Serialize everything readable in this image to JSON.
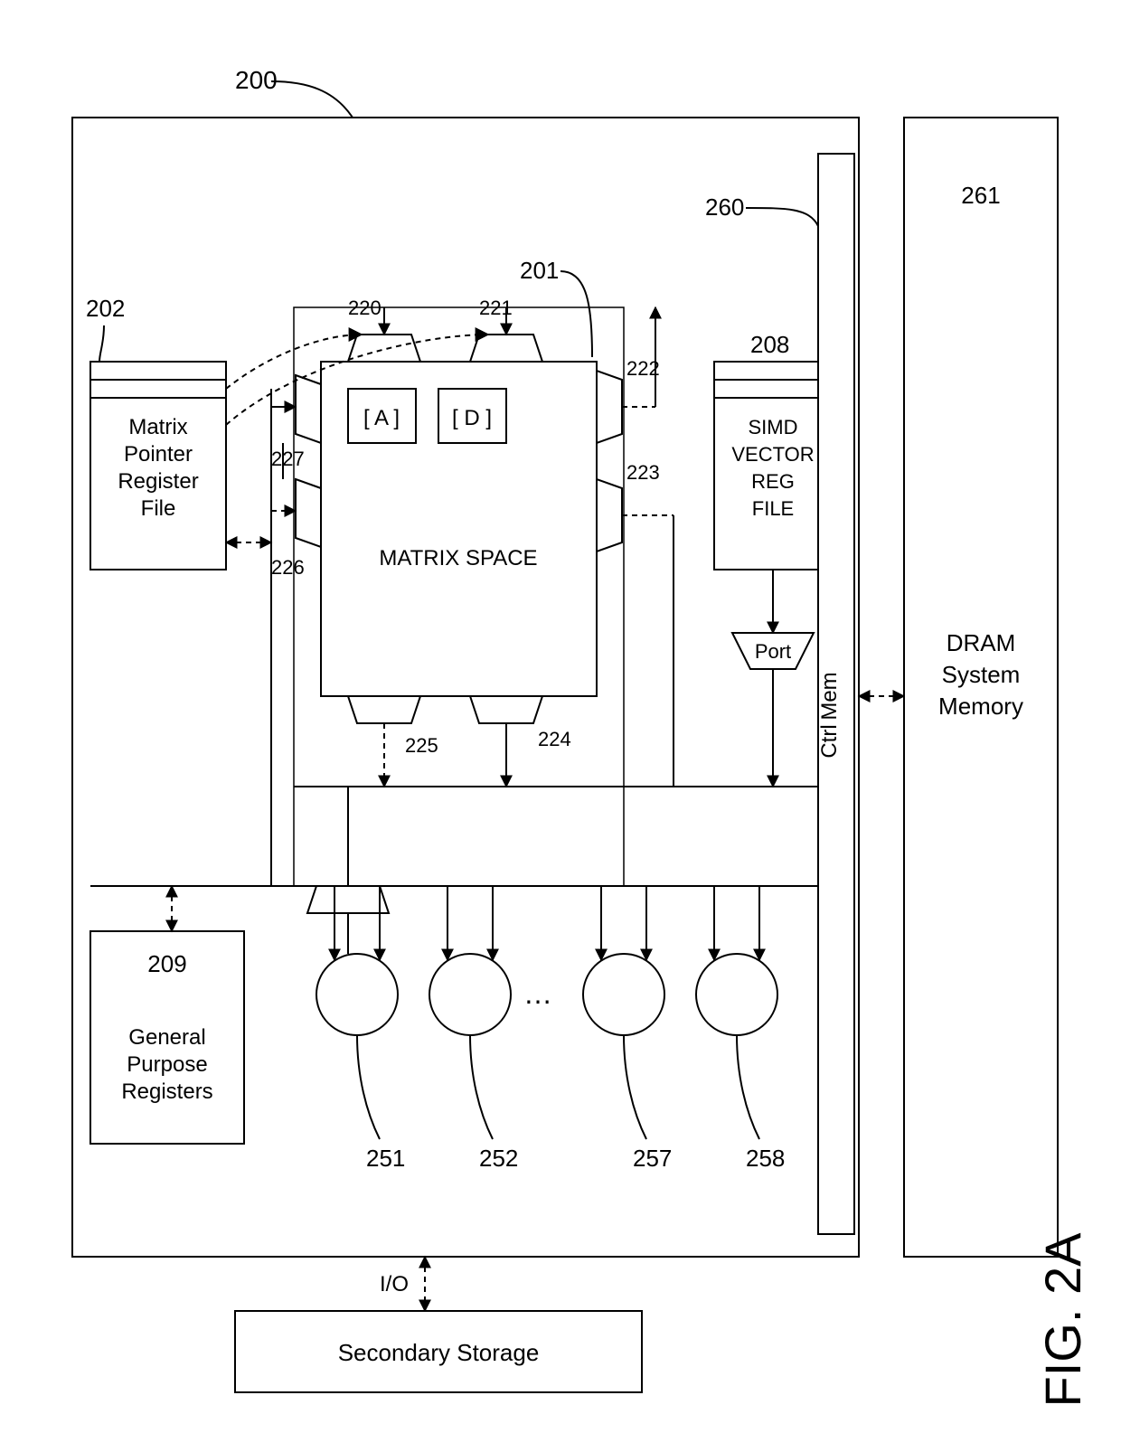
{
  "figure_label": "FIG. 2A",
  "refs": {
    "r200": "200",
    "r201": "201",
    "r202": "202",
    "r208": "208",
    "r209": "209",
    "r220": "220",
    "r221": "221",
    "r222": "222",
    "r223": "223",
    "r224": "224",
    "r225": "225",
    "r226": "226",
    "r227": "227",
    "r251": "251",
    "r252": "252",
    "r257": "257",
    "r258": "258",
    "r260": "260",
    "r261": "261"
  },
  "labels": {
    "matrix_space": "MATRIX SPACE",
    "A": "[ A ]",
    "D": "[ D ]",
    "mpf_1": "Matrix",
    "mpf_2": "Pointer",
    "mpf_3": "Register",
    "mpf_4": "File",
    "gpr_1": "General",
    "gpr_2": "Purpose",
    "gpr_3": "Registers",
    "simd_1": "SIMD",
    "simd_2": "VECTOR",
    "simd_3": "REG",
    "simd_4": "FILE",
    "port": "Port",
    "memctrl_1": "Mem",
    "memctrl_2": "Ctrl",
    "dram_1": "DRAM",
    "dram_2": "System",
    "dram_3": "Memory",
    "io": "I/O",
    "secondary": "Secondary Storage",
    "ellipsis": "…"
  }
}
